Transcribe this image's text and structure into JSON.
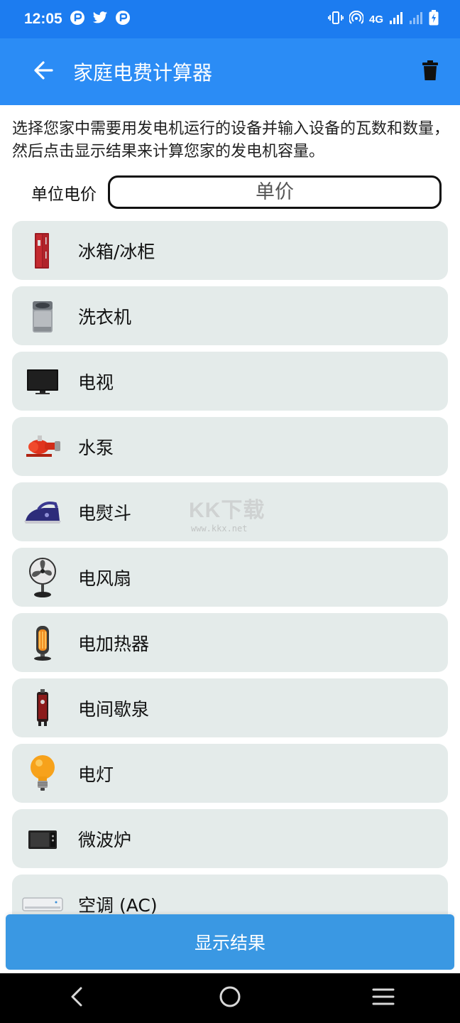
{
  "status_bar": {
    "time": "12:05",
    "network": "4G",
    "left_icons": [
      "app-notification-icon",
      "twitter-icon",
      "app-notification-icon"
    ],
    "right_icons": [
      "vibrate-icon",
      "hotspot-icon",
      "signal-icon",
      "signal-icon",
      "battery-charging-icon"
    ]
  },
  "app_bar": {
    "title": "家庭电费计算器",
    "back_icon": "arrow-left-icon",
    "delete_icon": "trash-icon",
    "color": "#2b8cf5"
  },
  "instructions": "选择您家中需要用发电机运行的设备并输入设备的瓦数和数量，然后点击显示结果来计算您家的发电机容量。",
  "unit_price": {
    "label": "单位电价",
    "placeholder": "单价",
    "value": ""
  },
  "devices": [
    {
      "label": "冰箱/冰柜",
      "icon": "refrigerator-icon"
    },
    {
      "label": "洗衣机",
      "icon": "washing-machine-icon"
    },
    {
      "label": "电视",
      "icon": "tv-icon"
    },
    {
      "label": "水泵",
      "icon": "water-pump-icon"
    },
    {
      "label": "电熨斗",
      "icon": "iron-icon"
    },
    {
      "label": "电风扇",
      "icon": "fan-icon"
    },
    {
      "label": "电加热器",
      "icon": "heater-icon"
    },
    {
      "label": "电间歇泉",
      "icon": "water-heater-icon"
    },
    {
      "label": "电灯",
      "icon": "light-bulb-icon"
    },
    {
      "label": "微波炉",
      "icon": "microwave-icon"
    },
    {
      "label": "空调 (AC)",
      "icon": "air-conditioner-icon"
    }
  ],
  "show_result_label": "显示结果",
  "watermark": {
    "main": "KK下载",
    "sub": "www.kkx.net"
  },
  "nav": {
    "back_icon": "nav-back-icon",
    "home_icon": "nav-home-icon",
    "menu_icon": "nav-menu-icon"
  },
  "colors": {
    "status_bar": "#1c7cf0",
    "card": "#e4ebea",
    "button": "#3a98e3"
  }
}
